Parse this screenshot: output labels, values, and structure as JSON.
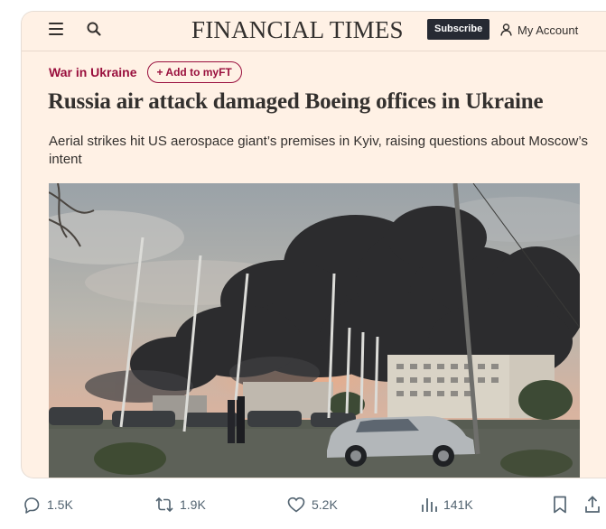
{
  "ft": {
    "logo": "FINANCIAL TIMES",
    "subscribe_label": "Subscribe",
    "account_label": "My Account",
    "icons": {
      "menu": "menu-icon",
      "search": "search-icon",
      "account": "user-icon"
    }
  },
  "article": {
    "topic": "War in Ukraine",
    "add_to_myft": "+ Add to myFT",
    "headline": "Russia air attack damaged Boeing offices in Ukraine",
    "standfirst": "Aerial strikes hit US aerospace giant’s premises in Kyiv, raising questions about Moscow’s intent"
  },
  "tweet_actions": {
    "replies": "1.5K",
    "reposts": "1.9K",
    "likes": "5.2K",
    "views": "141K",
    "icons": {
      "reply": "reply-icon",
      "repost": "repost-icon",
      "like": "heart-icon",
      "views": "views-icon",
      "bookmark": "bookmark-icon",
      "share": "share-icon"
    }
  },
  "colors": {
    "ft_pink": "#fff1e5",
    "ft_claret": "#990f3d",
    "ft_text": "#33302e",
    "subscribe_bg": "#262a33",
    "action_grey": "#536471"
  }
}
